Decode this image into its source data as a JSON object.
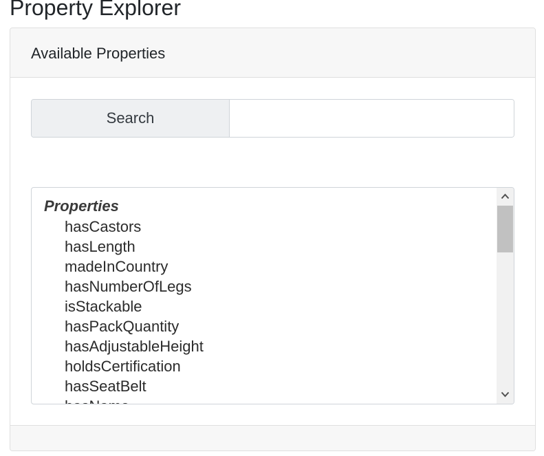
{
  "page": {
    "title": "Property Explorer"
  },
  "card": {
    "header_title": "Available Properties"
  },
  "search": {
    "button_label": "Search",
    "value": "",
    "placeholder": ""
  },
  "property_list": {
    "group_label": "Properties",
    "items": [
      "hasCastors",
      "hasLength",
      "madeInCountry",
      "hasNumberOfLegs",
      "isStackable",
      "hasPackQuantity",
      "hasAdjustableHeight",
      "holdsCertification",
      "hasSeatBelt",
      "hasName"
    ]
  },
  "scrollbar": {
    "up_icon": "chevron-up-icon",
    "down_icon": "chevron-down-icon"
  },
  "colors": {
    "card_header_bg": "#f7f7f7",
    "border": "#dfdfdf",
    "input_border": "#cfd4d9",
    "button_bg": "#eef0f2",
    "scroll_thumb": "#c1c1c1"
  }
}
